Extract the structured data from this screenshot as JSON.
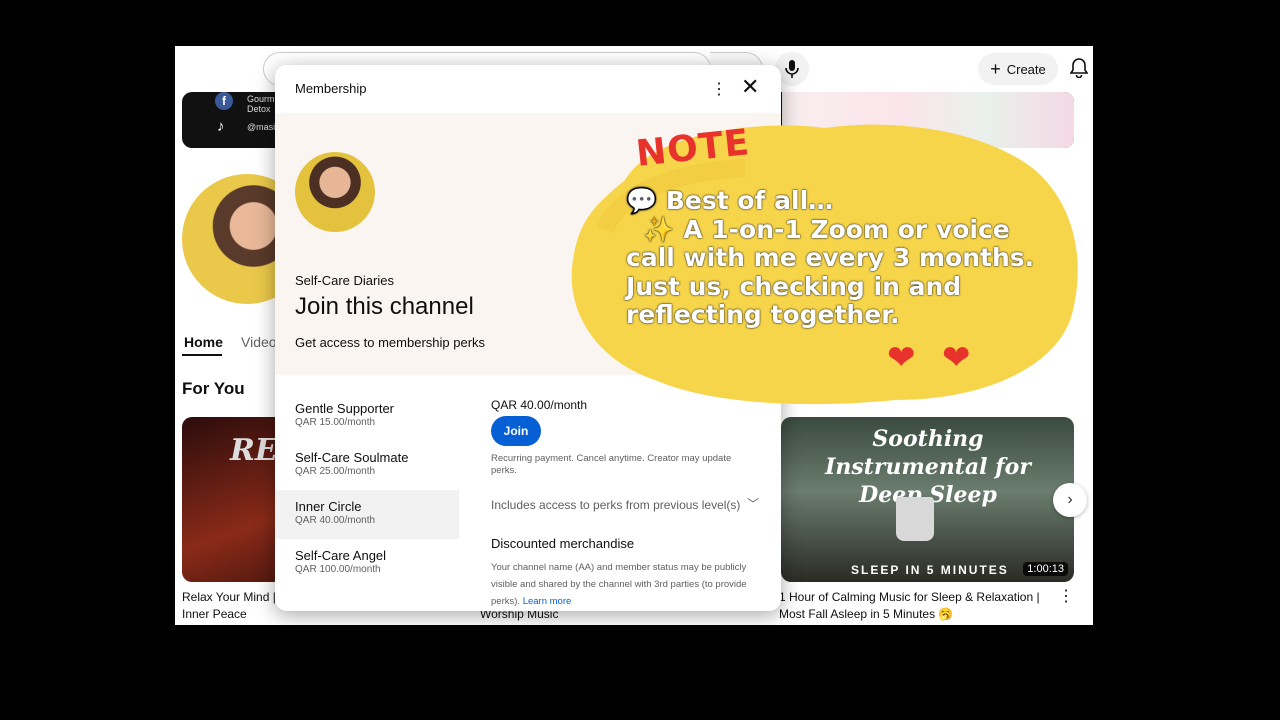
{
  "topbar": {
    "create_label": "Create"
  },
  "banner": {
    "line1": "Gourm",
    "line2": "Detox",
    "handle": "@masi"
  },
  "channel_tabs": {
    "home": "Home",
    "videos": "Video"
  },
  "section_title": "For You",
  "videos": [
    {
      "thumb_text": "RELA",
      "title_line1": "Relax Your Mind |",
      "title_line2": "Inner Peace"
    },
    {
      "title_line1": "",
      "title_line2": "Worship Music"
    },
    {
      "thumb_text": "Soothing Instrumental for Deep Sleep",
      "thumb_sub": "SLEEP IN 5 MINUTES",
      "duration": "1:00:13",
      "title_line1": "1 Hour of Calming Music for Sleep & Relaxation |",
      "title_line2": "Most Fall Asleep in 5 Minutes 🥱"
    }
  ],
  "dialog": {
    "title": "Membership",
    "channel_name": "Self-Care Diaries",
    "heading": "Join this channel",
    "subheading": "Get access to membership perks",
    "tiers": [
      {
        "name": "Gentle Supporter",
        "price": "QAR 15.00/month"
      },
      {
        "name": "Self-Care Soulmate",
        "price": "QAR 25.00/month"
      },
      {
        "name": "Inner Circle",
        "price": "QAR 40.00/month"
      },
      {
        "name": "Self-Care Angel",
        "price": "QAR 100.00/month"
      }
    ],
    "selected_price": "QAR 40.00/month",
    "join_label": "Join",
    "recurring": "Recurring payment. Cancel anytime. Creator may update perks.",
    "includes": "Includes access to perks from previous level(s)",
    "perk_title": "Discounted merchandise",
    "disclaimer": "Your channel name (AA) and member status may be publicly visible and shared by the channel with 3rd parties (to provide perks).",
    "learn_more": "Learn more"
  },
  "note": {
    "label": "NOTE",
    "text": "💬 Best of all…\n  ✨ A 1-on-1 Zoom or voice\ncall with me every 3 months.\nJust us, checking in and\nreflecting together."
  },
  "colors": {
    "accent": "#065fd4",
    "note_yellow": "#f7d54a",
    "note_red": "#e8322c"
  }
}
